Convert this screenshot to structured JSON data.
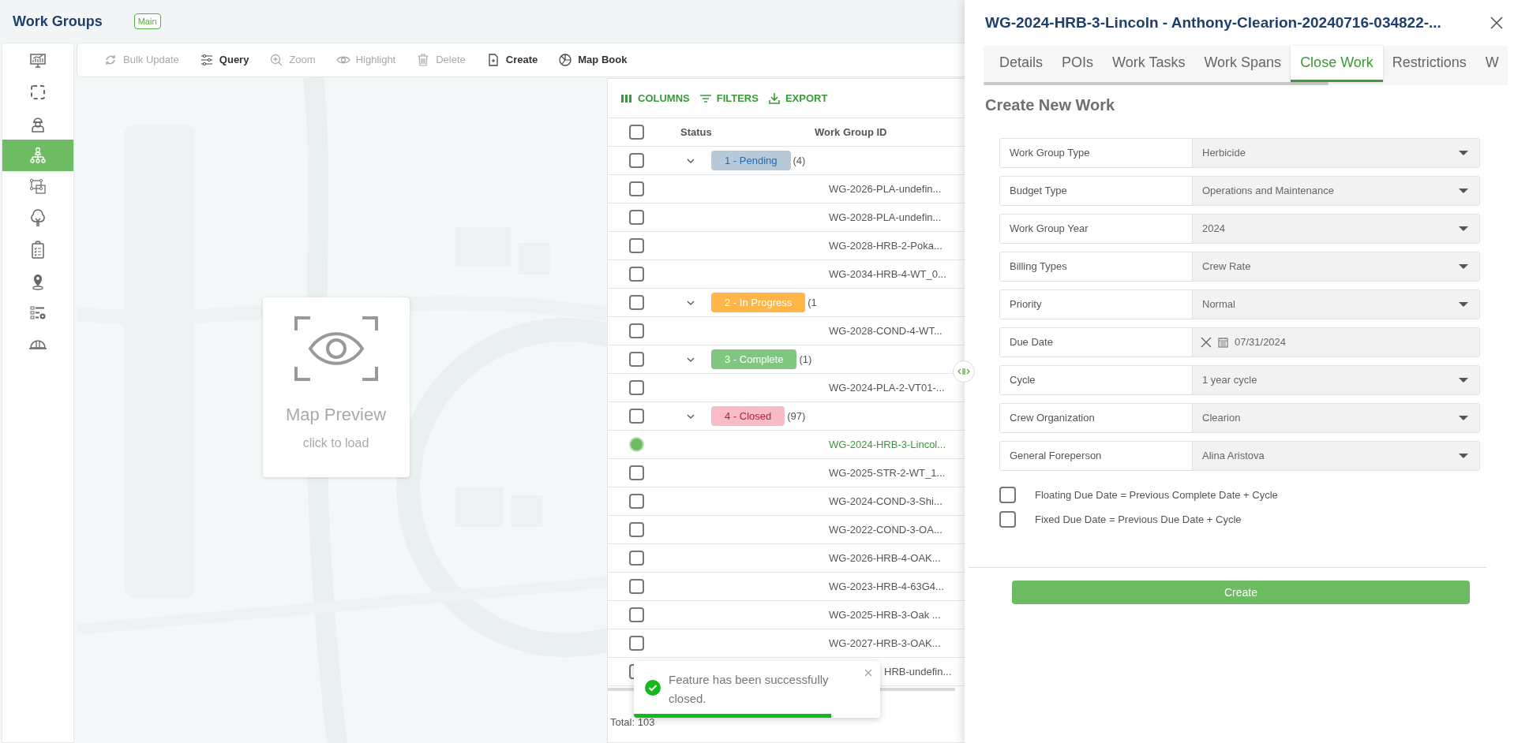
{
  "app": {
    "title": "Work Groups",
    "badge": "Main"
  },
  "sidebar": {
    "items": [
      {
        "selected": false
      },
      {
        "selected": false
      },
      {
        "selected": false
      },
      {
        "selected": true
      },
      {
        "selected": false
      },
      {
        "selected": false
      },
      {
        "selected": false
      },
      {
        "selected": false
      },
      {
        "selected": false
      },
      {
        "selected": false
      }
    ]
  },
  "toolbar": [
    {
      "label": "Bulk Update",
      "disabled": true
    },
    {
      "label": "Query",
      "disabled": false
    },
    {
      "label": "Zoom",
      "disabled": true
    },
    {
      "label": "Highlight",
      "disabled": true
    },
    {
      "label": "Delete",
      "disabled": true
    },
    {
      "label": "Create",
      "disabled": false
    },
    {
      "label": "Map Book",
      "disabled": false
    }
  ],
  "map_preview": {
    "title": "Map Preview",
    "hint": "click to load"
  },
  "table": {
    "actions": [
      "COLUMNS",
      "FILTERS",
      "EXPORT"
    ],
    "columns": [
      "Status",
      "Work Group ID"
    ],
    "all_checked": false,
    "rows": [
      {
        "kind": "group",
        "status": "1 - Pending",
        "count": "(4)",
        "color": "#b8c9da",
        "checked": false
      },
      {
        "kind": "item",
        "id": "WG-2026-PLA-undefin...",
        "selected": false
      },
      {
        "kind": "item",
        "id": "WG-2028-PLA-undefin...",
        "selected": false
      },
      {
        "kind": "item",
        "id": "WG-2028-HRB-2-Poka...",
        "selected": false
      },
      {
        "kind": "item",
        "id": "WG-2034-HRB-4-WT_0...",
        "selected": false
      },
      {
        "kind": "group",
        "status": "2 - In Progress",
        "count": "(1",
        "color": "#ffb547",
        "checked": false
      },
      {
        "kind": "item",
        "id": "WG-2028-COND-4-WT...",
        "selected": false
      },
      {
        "kind": "group",
        "status": "3 - Complete",
        "count": "(1)",
        "color": "#80c680",
        "checked": false
      },
      {
        "kind": "item",
        "id": "WG-2024-PLA-2-VT01-...",
        "selected": false
      },
      {
        "kind": "group",
        "status": "4 - Closed",
        "count": "(97)",
        "color": "#f8bcc6",
        "checked": false
      },
      {
        "kind": "item",
        "id": "WG-2024-HRB-3-Lincol...",
        "selected": true
      },
      {
        "kind": "item",
        "id": "WG-2025-STR-2-WT_1...",
        "selected": false
      },
      {
        "kind": "item",
        "id": "WG-2024-COND-3-Shi...",
        "selected": false
      },
      {
        "kind": "item",
        "id": "WG-2022-COND-3-OA...",
        "selected": false
      },
      {
        "kind": "item",
        "id": "WG-2026-HRB-4-OAK...",
        "selected": false
      },
      {
        "kind": "item",
        "id": "WG-2023-HRB-4-63G4...",
        "selected": false
      },
      {
        "kind": "item",
        "id": "WG-2025-HRB-3-Oak ...",
        "selected": false
      },
      {
        "kind": "item",
        "id": "WG-2027-HRB-3-OAK...",
        "selected": false
      },
      {
        "kind": "covered",
        "id": "HRB-undefin...",
        "selected": false
      }
    ],
    "total": "Total: 103"
  },
  "panel": {
    "title": "WG-2024-HRB-3-Lincoln - Anthony-Clearion-20240716-034822-...",
    "tabs": [
      {
        "label": "Details",
        "selected": false
      },
      {
        "label": "POIs",
        "selected": false
      },
      {
        "label": "Work Tasks",
        "selected": false
      },
      {
        "label": "Work Spans",
        "selected": false
      },
      {
        "label": "Close Work",
        "selected": true
      },
      {
        "label": "Restrictions",
        "selected": false
      },
      {
        "label": "W",
        "selected": false
      }
    ],
    "heading": "Create New Work",
    "fields": [
      {
        "kind": "select",
        "label": "Work Group Type",
        "value": "Herbicide"
      },
      {
        "kind": "select",
        "label": "Budget Type",
        "value": "Operations and Maintenance"
      },
      {
        "kind": "select",
        "label": "Work Group Year",
        "value": "2024"
      },
      {
        "kind": "select",
        "label": "Billing Types",
        "value": "Crew Rate"
      },
      {
        "kind": "select",
        "label": "Priority",
        "value": "Normal"
      },
      {
        "kind": "date",
        "label": "Due Date",
        "value": "07/31/2024"
      },
      {
        "kind": "select",
        "label": "Cycle",
        "value": "1 year cycle"
      },
      {
        "kind": "select",
        "label": "Crew Organization",
        "value": "Clearion"
      },
      {
        "kind": "select",
        "label": "General Foreperson",
        "value": "Alina Aristova"
      }
    ],
    "checkboxes": [
      {
        "label": "Floating Due Date = Previous Complete Date + Cycle",
        "checked": false
      },
      {
        "label": "Fixed Due Date = Previous Due Date + Cycle",
        "checked": false
      }
    ],
    "button": "Create"
  },
  "toast": {
    "message": "Feature has been successfully closed.",
    "level": 0.8
  }
}
